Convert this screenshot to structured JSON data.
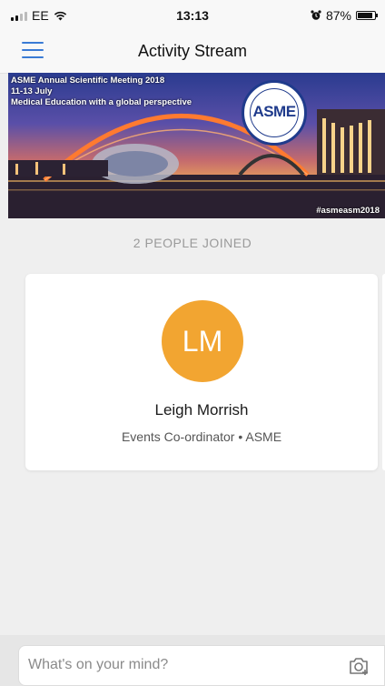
{
  "status_bar": {
    "carrier": "EE",
    "time": "13:13",
    "battery_text": "87%",
    "battery_level": 0.87
  },
  "nav": {
    "title": "Activity Stream",
    "menu_icon": "hamburger-menu-icon"
  },
  "banner": {
    "line1": "ASME Annual Scientific Meeting 2018",
    "line2": "11-13 July",
    "line3": "Medical Education with a global perspective",
    "hashtag": "#asmeasm2018",
    "logo_word": "ASME",
    "logo_ring_text": "ASSOCIATION FOR THE STUDY OF MEDICAL EDUCATION"
  },
  "joined": {
    "label": "2 PEOPLE JOINED"
  },
  "person": {
    "initials": "LM",
    "name": "Leigh Morrish",
    "role": "Events Co-ordinator • ASME",
    "avatar_color": "#f2a531"
  },
  "composer": {
    "placeholder": "What's on your mind?",
    "camera_icon": "camera-add-icon"
  },
  "colors": {
    "accent": "#3a7bd5",
    "background": "#efefef"
  }
}
